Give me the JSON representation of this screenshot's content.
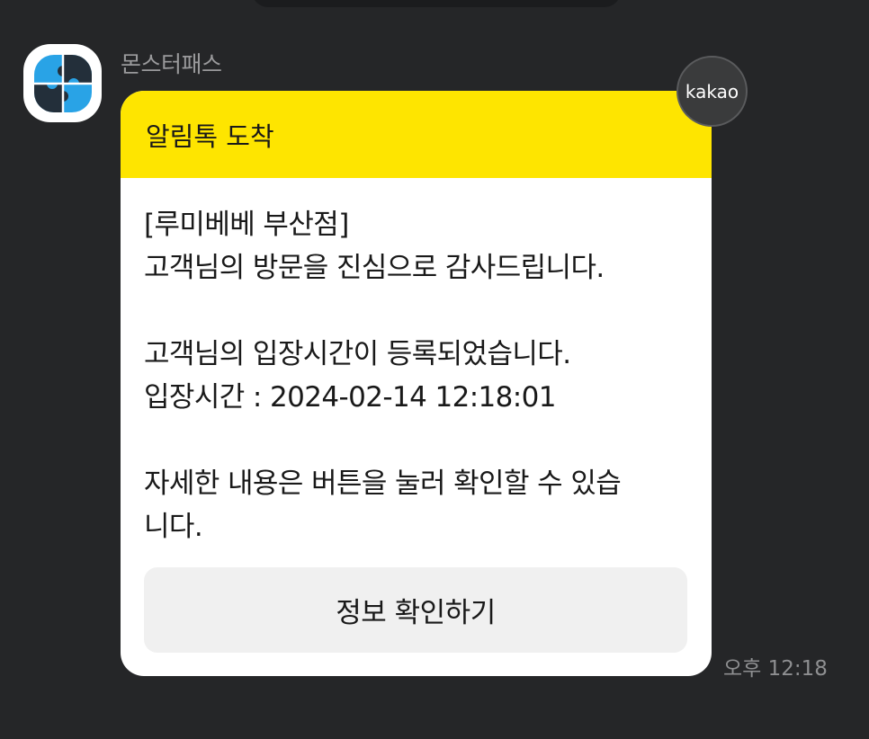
{
  "chat": {
    "sender_name": "몬스터패스",
    "time": "오후 12:18",
    "badge_text": "kakao"
  },
  "message": {
    "header": "알림톡 도착",
    "lines": [
      "[루미베베 부산점]",
      "고객님의 방문을 진심으로 감사드립니다.",
      "",
      "고객님의 입장시간이 등록되었습니다.",
      "입장시간 : 2024-02-14 12:18:01",
      "",
      "자세한 내용은 버튼을 눌러 확인할 수 있습",
      "니다."
    ],
    "button_label": "정보 확인하기"
  },
  "colors": {
    "background": "#252628",
    "header_yellow": "#fee500",
    "bubble": "#ffffff",
    "button_bg": "#f0f0f0",
    "logo_blue": "#29a3e6",
    "logo_dark": "#232f3a"
  },
  "icons": {
    "profile": "puzzle-logo-icon"
  }
}
